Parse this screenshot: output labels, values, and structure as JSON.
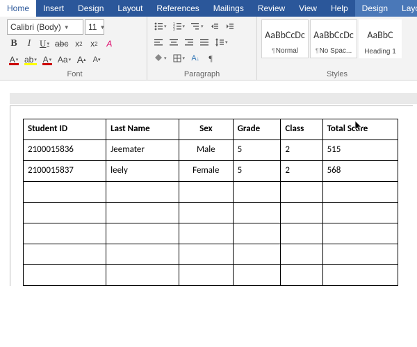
{
  "tabs": {
    "home": "Home",
    "insert": "Insert",
    "design": "Design",
    "layout": "Layout",
    "references": "References",
    "mailings": "Mailings",
    "review": "Review",
    "view": "View",
    "help": "Help",
    "ctx_design": "Design",
    "ctx_layout": "Layout"
  },
  "font": {
    "name": "Calibri (Body)",
    "size": "11",
    "bold": "B",
    "italic": "I",
    "underline": "U",
    "strike": "abc",
    "sub": "x",
    "sup": "x",
    "highlight": "ab",
    "fontcolor": "A",
    "textfill": "A",
    "case": "Aa",
    "grow": "A",
    "shrink": "A",
    "clear": "A",
    "group_label": "Font"
  },
  "paragraph": {
    "group_label": "Paragraph"
  },
  "styles": {
    "group_label": "Styles",
    "preview": "AaBbCcDc",
    "style1": "Normal",
    "style2": "No Spac...",
    "style3": "Heading 1",
    "preview3": "AaBbC"
  },
  "table": {
    "headers": [
      "Student ID",
      "Last Name",
      "Sex",
      "Grade",
      "Class",
      "Total Score"
    ],
    "rows": [
      {
        "id": "2100015836",
        "last": "Jeemater",
        "sex": "Male",
        "grade": "5",
        "class": "2",
        "score": "515"
      },
      {
        "id": "2100015837",
        "last": "leely",
        "sex": "Female",
        "grade": "5",
        "class": "2",
        "score": "568"
      },
      {
        "id": "",
        "last": "",
        "sex": "",
        "grade": "",
        "class": "",
        "score": ""
      },
      {
        "id": "",
        "last": "",
        "sex": "",
        "grade": "",
        "class": "",
        "score": ""
      },
      {
        "id": "",
        "last": "",
        "sex": "",
        "grade": "",
        "class": "",
        "score": ""
      },
      {
        "id": "",
        "last": "",
        "sex": "",
        "grade": "",
        "class": "",
        "score": ""
      },
      {
        "id": "",
        "last": "",
        "sex": "",
        "grade": "",
        "class": "",
        "score": ""
      }
    ]
  }
}
